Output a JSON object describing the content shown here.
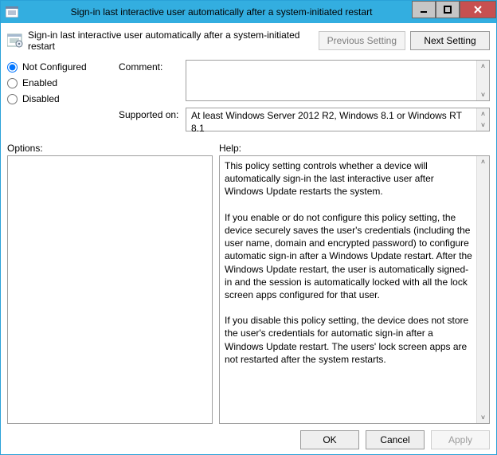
{
  "window": {
    "title": "Sign-in last interactive user automatically after a system-initiated restart"
  },
  "header": {
    "policy_name": "Sign-in last interactive user automatically after a system-initiated restart",
    "prev_label": "Previous Setting",
    "next_label": "Next Setting"
  },
  "state": {
    "options": {
      "not_configured": "Not Configured",
      "enabled": "Enabled",
      "disabled": "Disabled"
    },
    "selected": "not_configured"
  },
  "fields": {
    "comment_label": "Comment:",
    "comment_value": "",
    "supported_label": "Supported on:",
    "supported_value": "At least Windows Server 2012 R2, Windows 8.1 or Windows RT 8.1"
  },
  "panes": {
    "options_label": "Options:",
    "help_label": "Help:",
    "help_text": "This policy setting controls whether a device will automatically sign-in the last interactive user after Windows Update restarts the system.\n\nIf you enable or do not configure this policy setting, the device securely saves the user's credentials (including the user name, domain and encrypted password) to configure automatic sign-in after a Windows Update restart. After the Windows Update restart, the user is automatically signed-in and the session is automatically locked with all the lock screen apps configured for that user.\n\nIf you disable this policy setting, the device does not store the user's credentials for automatic sign-in after a Windows Update restart. The users' lock screen apps are not restarted after the system restarts."
  },
  "footer": {
    "ok": "OK",
    "cancel": "Cancel",
    "apply": "Apply"
  }
}
